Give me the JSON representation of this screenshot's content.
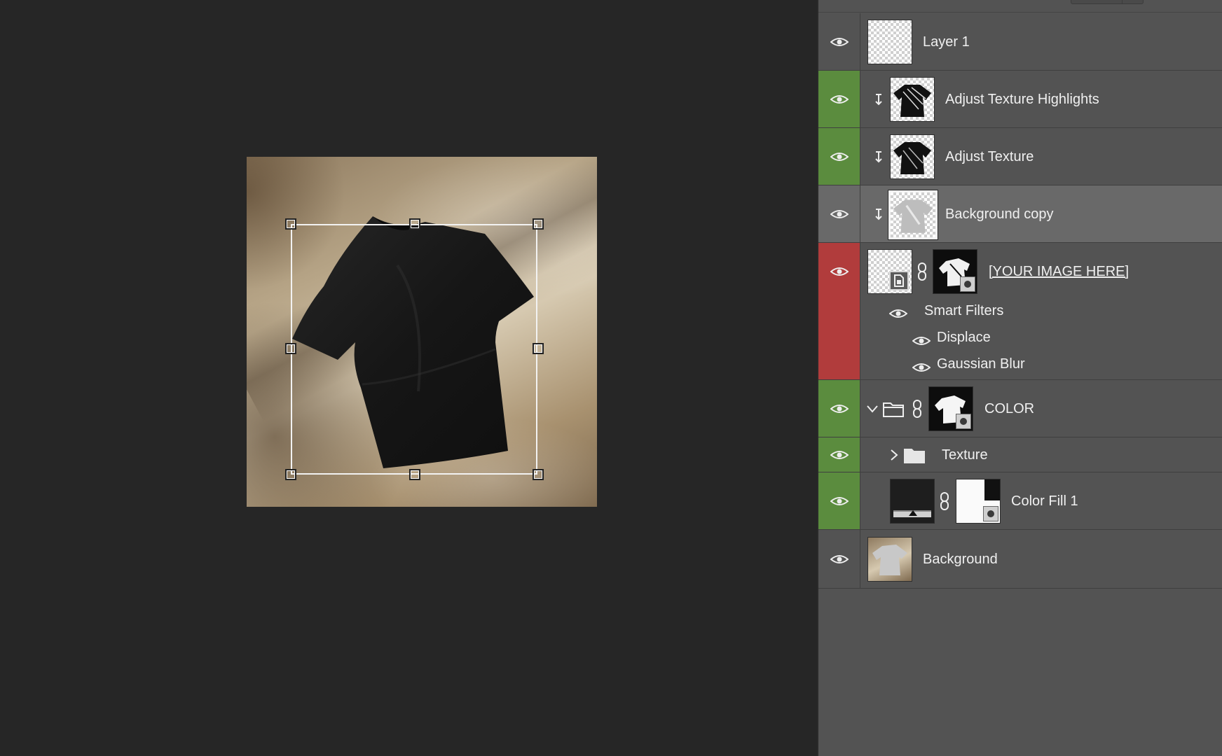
{
  "panel": {
    "name": "Layers"
  },
  "layers": [
    {
      "name": "Layer 1",
      "visibility_color": "none"
    },
    {
      "name": "Adjust Texture Highlights",
      "visibility_color": "#5b8c3e",
      "clipped": true
    },
    {
      "name": "Adjust Texture",
      "visibility_color": "#5b8c3e",
      "clipped": true
    },
    {
      "name": "Background copy",
      "visibility_color": "none",
      "clipped": true,
      "selected": true
    },
    {
      "name": "[YOUR IMAGE HERE]",
      "visibility_color": "#b13c3c",
      "smart_object": true,
      "smart_filters": {
        "label": "Smart Filters",
        "filters": [
          "Displace",
          "Gaussian Blur"
        ]
      }
    },
    {
      "name": "COLOR",
      "visibility_color": "#5b8c3e",
      "group": true,
      "expanded": true
    },
    {
      "name": "Texture",
      "visibility_color": "#5b8c3e",
      "group": true,
      "expanded": false
    },
    {
      "name": "Color Fill 1",
      "visibility_color": "#5b8c3e"
    },
    {
      "name": "Background",
      "visibility_color": "none"
    }
  ],
  "icons": {
    "eye": "eye-icon",
    "clip": "clipping-arrow-icon",
    "link": "chain-link-icon",
    "folder": "folder-icon",
    "chevron_down": "chevron-down-icon",
    "chevron_right": "chevron-right-icon"
  },
  "colors": {
    "panel_bg": "#535353",
    "selected_bg": "#696969",
    "canvas_bg": "#262626",
    "green_tag": "#5b8c3e",
    "red_tag": "#b13c3c"
  }
}
